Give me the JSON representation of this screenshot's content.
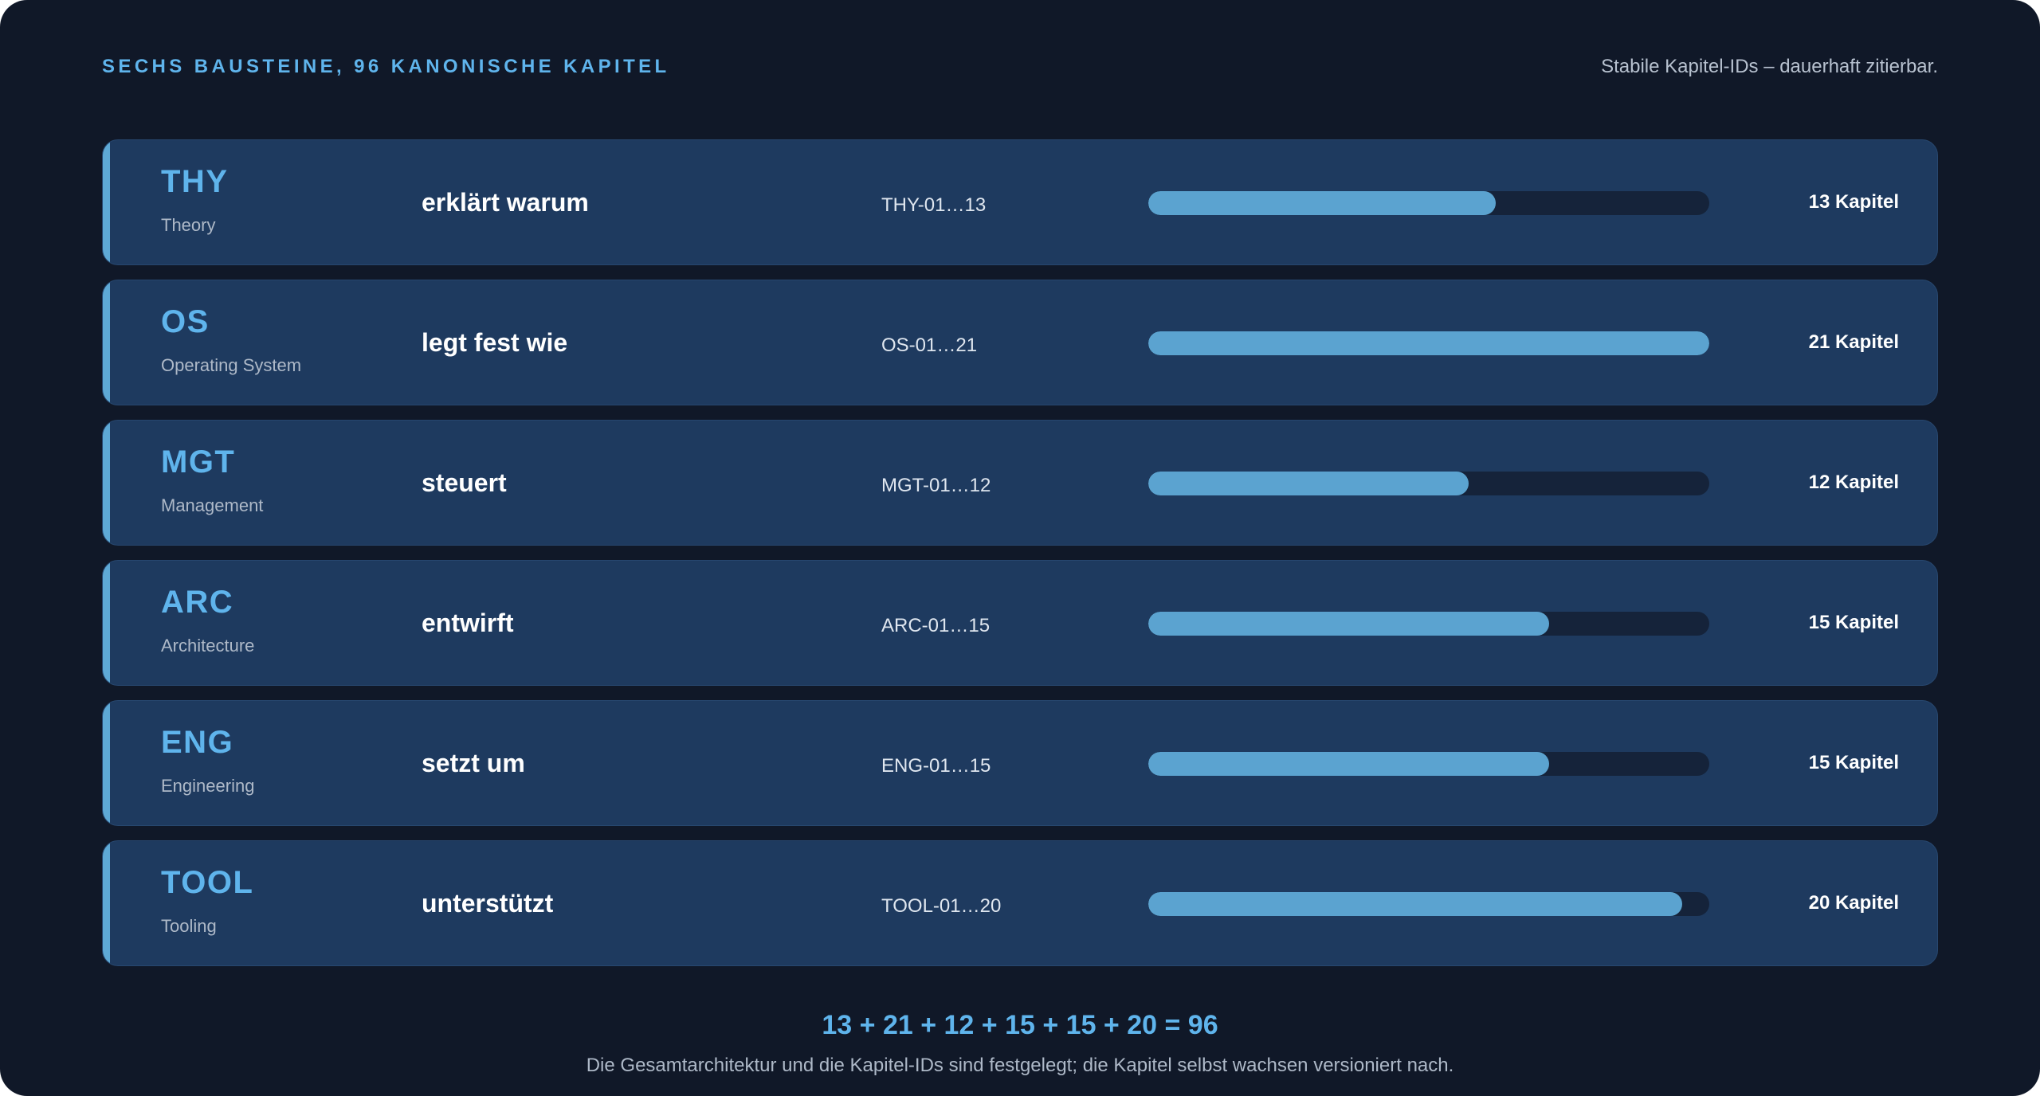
{
  "header": {
    "title": "SECHS BAUSTEINE, 96 KANONISCHE KAPITEL",
    "note": "Stabile Kapitel-IDs – dauerhaft zitierbar."
  },
  "colors": {
    "background": "#101828",
    "card": "#1e3a5f",
    "accent": "#5fb4ec",
    "bar_fill": "#5ba3d0",
    "bar_track": "#15233a"
  },
  "max_chapters": 21,
  "modules": [
    {
      "code": "THY",
      "name": "Theory",
      "role": "erklärt warum",
      "range": "THY-01…13",
      "chapters": 13,
      "count_label": "13 Kapitel"
    },
    {
      "code": "OS",
      "name": "Operating System",
      "role": "legt fest wie",
      "range": "OS-01…21",
      "chapters": 21,
      "count_label": "21 Kapitel"
    },
    {
      "code": "MGT",
      "name": "Management",
      "role": "steuert",
      "range": "MGT-01…12",
      "chapters": 12,
      "count_label": "12 Kapitel"
    },
    {
      "code": "ARC",
      "name": "Architecture",
      "role": "entwirft",
      "range": "ARC-01…15",
      "chapters": 15,
      "count_label": "15 Kapitel"
    },
    {
      "code": "ENG",
      "name": "Engineering",
      "role": "setzt um",
      "range": "ENG-01…15",
      "chapters": 15,
      "count_label": "15 Kapitel"
    },
    {
      "code": "TOOL",
      "name": "Tooling",
      "role": "unterstützt",
      "range": "TOOL-01…20",
      "chapters": 20,
      "count_label": "20 Kapitel"
    }
  ],
  "summary": {
    "equation": "13 + 21 + 12 + 15 + 15 + 20 = 96",
    "note": "Die Gesamtarchitektur und die Kapitel-IDs sind festgelegt; die Kapitel selbst wachsen versioniert nach."
  }
}
